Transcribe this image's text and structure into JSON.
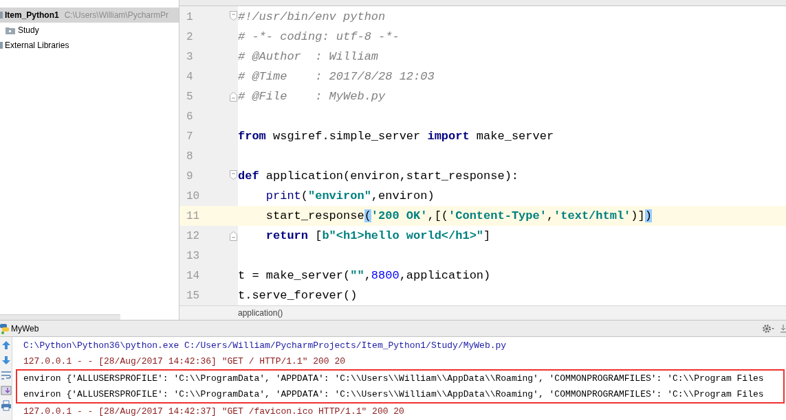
{
  "project": {
    "items": [
      {
        "label": "Item_Python1",
        "path": "C:\\Users\\William\\PycharmPr",
        "kind": "project",
        "selected": true
      },
      {
        "label": "Study",
        "kind": "folder",
        "selected": false
      },
      {
        "label": "External Libraries",
        "kind": "library",
        "selected": false
      }
    ]
  },
  "editor": {
    "lines": [
      {
        "number": "1",
        "fold_start": true,
        "fold_end": false,
        "indented": false,
        "current": false,
        "tokens": [
          {
            "text": "#!/usr/bin/env python",
            "kind": "comment"
          }
        ]
      },
      {
        "number": "2",
        "fold_start": false,
        "fold_end": false,
        "indented": false,
        "current": false,
        "tokens": [
          {
            "text": "# -*- coding: utf-8 -*-",
            "kind": "comment"
          }
        ]
      },
      {
        "number": "3",
        "fold_start": false,
        "fold_end": false,
        "indented": false,
        "current": false,
        "tokens": [
          {
            "text": "# @Author  : William",
            "kind": "comment"
          }
        ]
      },
      {
        "number": "4",
        "fold_start": false,
        "fold_end": false,
        "indented": false,
        "current": false,
        "tokens": [
          {
            "text": "# @Time    : 2017/8/28 12:03",
            "kind": "comment"
          }
        ]
      },
      {
        "number": "5",
        "fold_start": false,
        "fold_end": true,
        "indented": false,
        "current": false,
        "tokens": [
          {
            "text": "# @File    : MyWeb.py",
            "kind": "comment"
          }
        ]
      },
      {
        "number": "6",
        "fold_start": false,
        "fold_end": false,
        "current": false
      },
      {
        "number": "7",
        "fold_start": false,
        "fold_end": false,
        "indented": false,
        "current": false,
        "tokens": [
          {
            "text": "from",
            "kind": "keyword"
          },
          {
            "text": " wsgiref.simple_server ",
            "kind": "plain"
          },
          {
            "text": "import",
            "kind": "keyword"
          },
          {
            "text": " make_server",
            "kind": "plain"
          }
        ]
      },
      {
        "number": "8",
        "fold_start": false,
        "fold_end": false,
        "current": false
      },
      {
        "number": "9",
        "fold_start": true,
        "fold_end": false,
        "indented": false,
        "current": false,
        "tokens": [
          {
            "text": "def",
            "kind": "keyword"
          },
          {
            "text": " application(environ,start_response):",
            "kind": "plain"
          }
        ]
      },
      {
        "number": "10",
        "fold_start": false,
        "fold_end": false,
        "indented": true,
        "current": false,
        "tokens": [
          {
            "text": "print",
            "kind": "builtin"
          },
          {
            "text": "(",
            "kind": "plain"
          },
          {
            "text": "\"environ\"",
            "kind": "string"
          },
          {
            "text": ",environ)",
            "kind": "plain"
          }
        ]
      },
      {
        "number": "11",
        "fold_start": false,
        "fold_end": false,
        "indented": true,
        "current": true,
        "tokens": [
          {
            "text": "start_response",
            "kind": "plain"
          },
          {
            "text": "(",
            "kind": "match"
          },
          {
            "text": "'200 OK'",
            "kind": "string"
          },
          {
            "text": ",[(",
            "kind": "plain"
          },
          {
            "text": "'Content-Type'",
            "kind": "string"
          },
          {
            "text": ",",
            "kind": "plain"
          },
          {
            "text": "'text/html'",
            "kind": "string"
          },
          {
            "text": ")]",
            "kind": "plain"
          },
          {
            "text": ")",
            "kind": "match"
          }
        ]
      },
      {
        "number": "12",
        "fold_start": false,
        "fold_end": true,
        "indented": true,
        "current": false,
        "tokens": [
          {
            "text": "return",
            "kind": "keyword"
          },
          {
            "text": " [",
            "kind": "plain"
          },
          {
            "text": "b\"<h1>hello world</h1>\"",
            "kind": "string"
          },
          {
            "text": "]",
            "kind": "plain"
          }
        ]
      },
      {
        "number": "13",
        "fold_start": false,
        "fold_end": false,
        "current": false
      },
      {
        "number": "14",
        "fold_start": false,
        "fold_end": false,
        "indented": false,
        "current": false,
        "tokens": [
          {
            "text": "t = make_server(",
            "kind": "plain"
          },
          {
            "text": "\"\"",
            "kind": "string"
          },
          {
            "text": ",",
            "kind": "plain"
          },
          {
            "text": "8800",
            "kind": "number"
          },
          {
            "text": ",application)",
            "kind": "plain"
          }
        ]
      },
      {
        "number": "15",
        "fold_start": false,
        "fold_end": false,
        "indented": false,
        "current": false,
        "tokens": [
          {
            "text": "t.serve_forever()",
            "kind": "plain"
          }
        ]
      }
    ],
    "breadcrumb": "application()"
  },
  "run": {
    "title": "MyWeb",
    "lines": [
      {
        "text": "C:\\Python\\Python36\\python.exe C:/Users/William/PycharmProjects/Item_Python1/Study/MyWeb.py",
        "kind": "command",
        "boxed": false
      },
      {
        "text": "127.0.0.1 - - [28/Aug/2017 14:42:36] \"GET / HTTP/1.1\" 200 20",
        "kind": "log",
        "boxed": false
      },
      {
        "text": "environ {'ALLUSERSPROFILE': 'C:\\\\ProgramData', 'APPDATA': 'C:\\\\Users\\\\William\\\\AppData\\\\Roaming', 'COMMONPROGRAMFILES': 'C:\\\\Program Files",
        "kind": "output",
        "boxed": true
      },
      {
        "text": "environ {'ALLUSERSPROFILE': 'C:\\\\ProgramData', 'APPDATA': 'C:\\\\Users\\\\William\\\\AppData\\\\Roaming', 'COMMONPROGRAMFILES': 'C:\\\\Program Files",
        "kind": "output",
        "boxed": true
      },
      {
        "text": "127.0.0.1 - - [28/Aug/2017 14:42:37] \"GET /favicon.ico HTTP/1.1\" 200 20",
        "kind": "log",
        "boxed": false
      }
    ]
  }
}
